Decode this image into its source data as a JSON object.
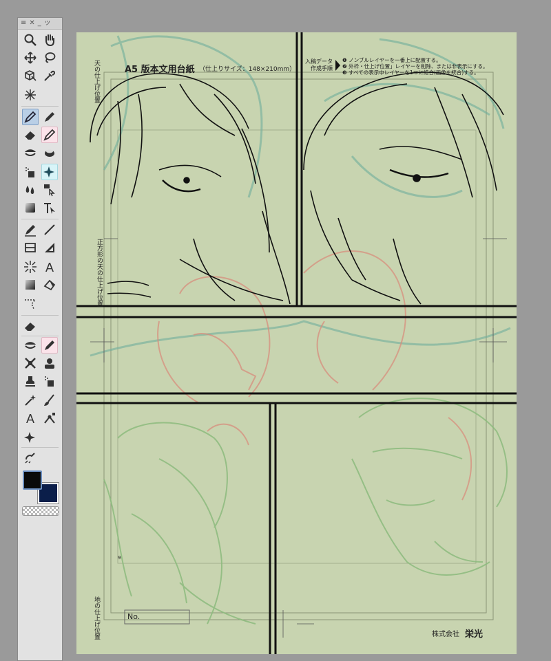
{
  "palette": {
    "header_icons": [
      "menu-icon",
      "close-icon",
      "minimize-icon",
      "collapse-icon"
    ],
    "header_glyphs": {
      "menu": "≡",
      "close": "✕",
      "minimize": "_",
      "collapse": "ッ"
    },
    "colors": {
      "main": "#0a0a0a",
      "sub": "#0b1e4a"
    }
  },
  "manuscript": {
    "title": "A5 版本文用台紙",
    "size_note": "（仕上りサイズ：148×210mm）",
    "submission_heading": "入稿データ\n作成手順",
    "instructions": [
      "❶ ノンブルレイヤーを一番上に配置する。",
      "❷ 外枠・仕上げ位置」レイヤーを削除、または非表示にする。",
      "❸ すべての表示中レイヤーを1つに結合(画像を統合)する。"
    ],
    "top_margin_label": "天の仕上げ位置",
    "side_label": "正方形の天の仕上げ位置",
    "bottom_margin_label": "地の仕上げ位置",
    "page_number": "9",
    "no_label": "No.",
    "company_prefix": "株式会社",
    "company_name": "栄光"
  }
}
